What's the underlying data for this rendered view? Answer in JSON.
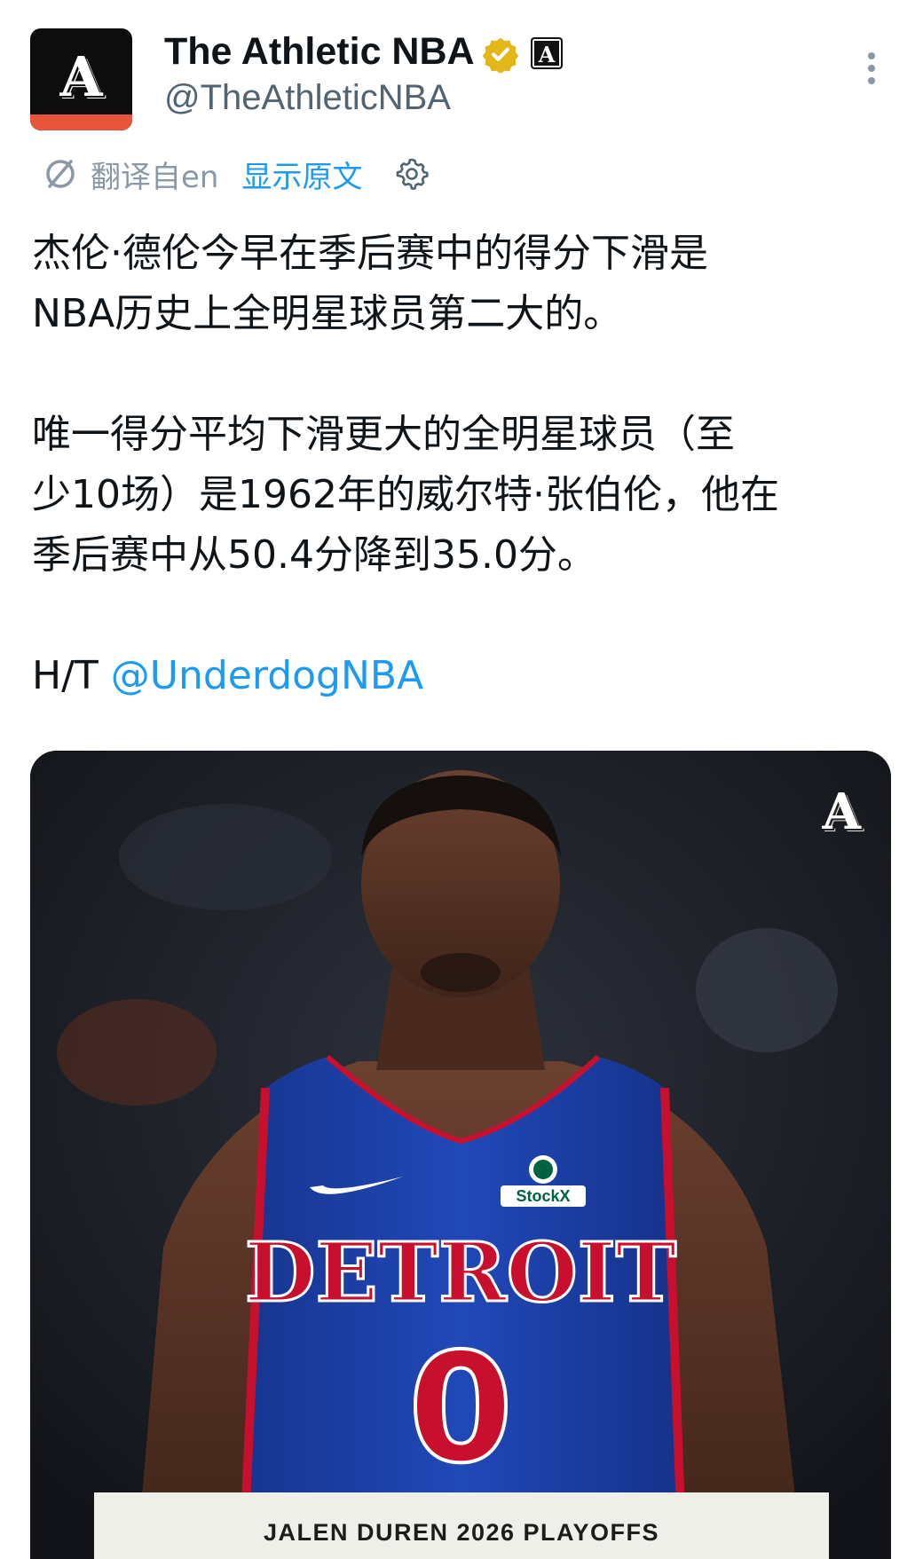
{
  "header": {
    "display_name": "The Athletic NBA",
    "handle": "@TheAthleticNBA",
    "avatar_glyph": "A",
    "affiliate_badge": "A"
  },
  "translation": {
    "label": "翻译自en",
    "show_original": "显示原文"
  },
  "tweet": {
    "lines": [
      "杰伦·德伦今早在季后赛中的得分下滑是",
      "NBA历史上全明星球员第二大的。",
      "唯一得分平均下滑更大的全明星球员（至",
      "少10场）是1962年的威尔特·张伯伦，他在",
      "季后赛中从50.4分降到35.0分。"
    ],
    "ht_prefix": "H/T ",
    "mention": "@UnderdogNBA"
  },
  "media": {
    "watermark": "A",
    "jersey_team": "DETROIT",
    "jersey_number": "0",
    "sponsor": "StockX",
    "caption": "JALEN DUREN 2026 PLAYOFFS"
  },
  "colors": {
    "link": "#1d9bf0",
    "verified_gold": "#e2b719",
    "jersey_blue": "#1d42ba",
    "jersey_red": "#c8102e"
  }
}
